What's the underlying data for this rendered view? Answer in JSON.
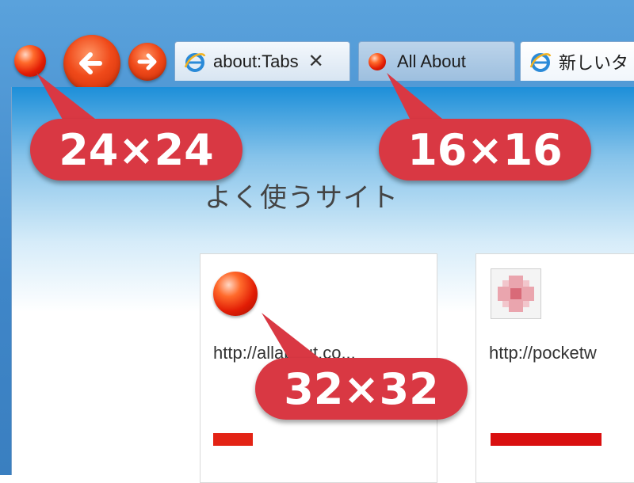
{
  "tabs": [
    {
      "label": "about:Tabs",
      "close": "✕",
      "icon": "ie-icon"
    },
    {
      "label": "All About",
      "icon": "favicon-orb-icon"
    },
    {
      "label": "新しいタ",
      "icon": "ie-icon"
    }
  ],
  "content": {
    "section_title": "よく使うサイト",
    "cards": [
      {
        "url": "http://allabout.co...",
        "icon": "orb-favicon-icon",
        "bar_color": "#e32315"
      },
      {
        "url": "http://pocketw",
        "icon": "pixelated-favicon-icon",
        "bar_color": "#d90f0f"
      }
    ]
  },
  "callouts": {
    "size24": "24×24",
    "size16": "16×16",
    "size32": "32×32"
  },
  "colors": {
    "callout": "#d93843",
    "orb": "#e21d05",
    "frame": "#3f86c8"
  }
}
